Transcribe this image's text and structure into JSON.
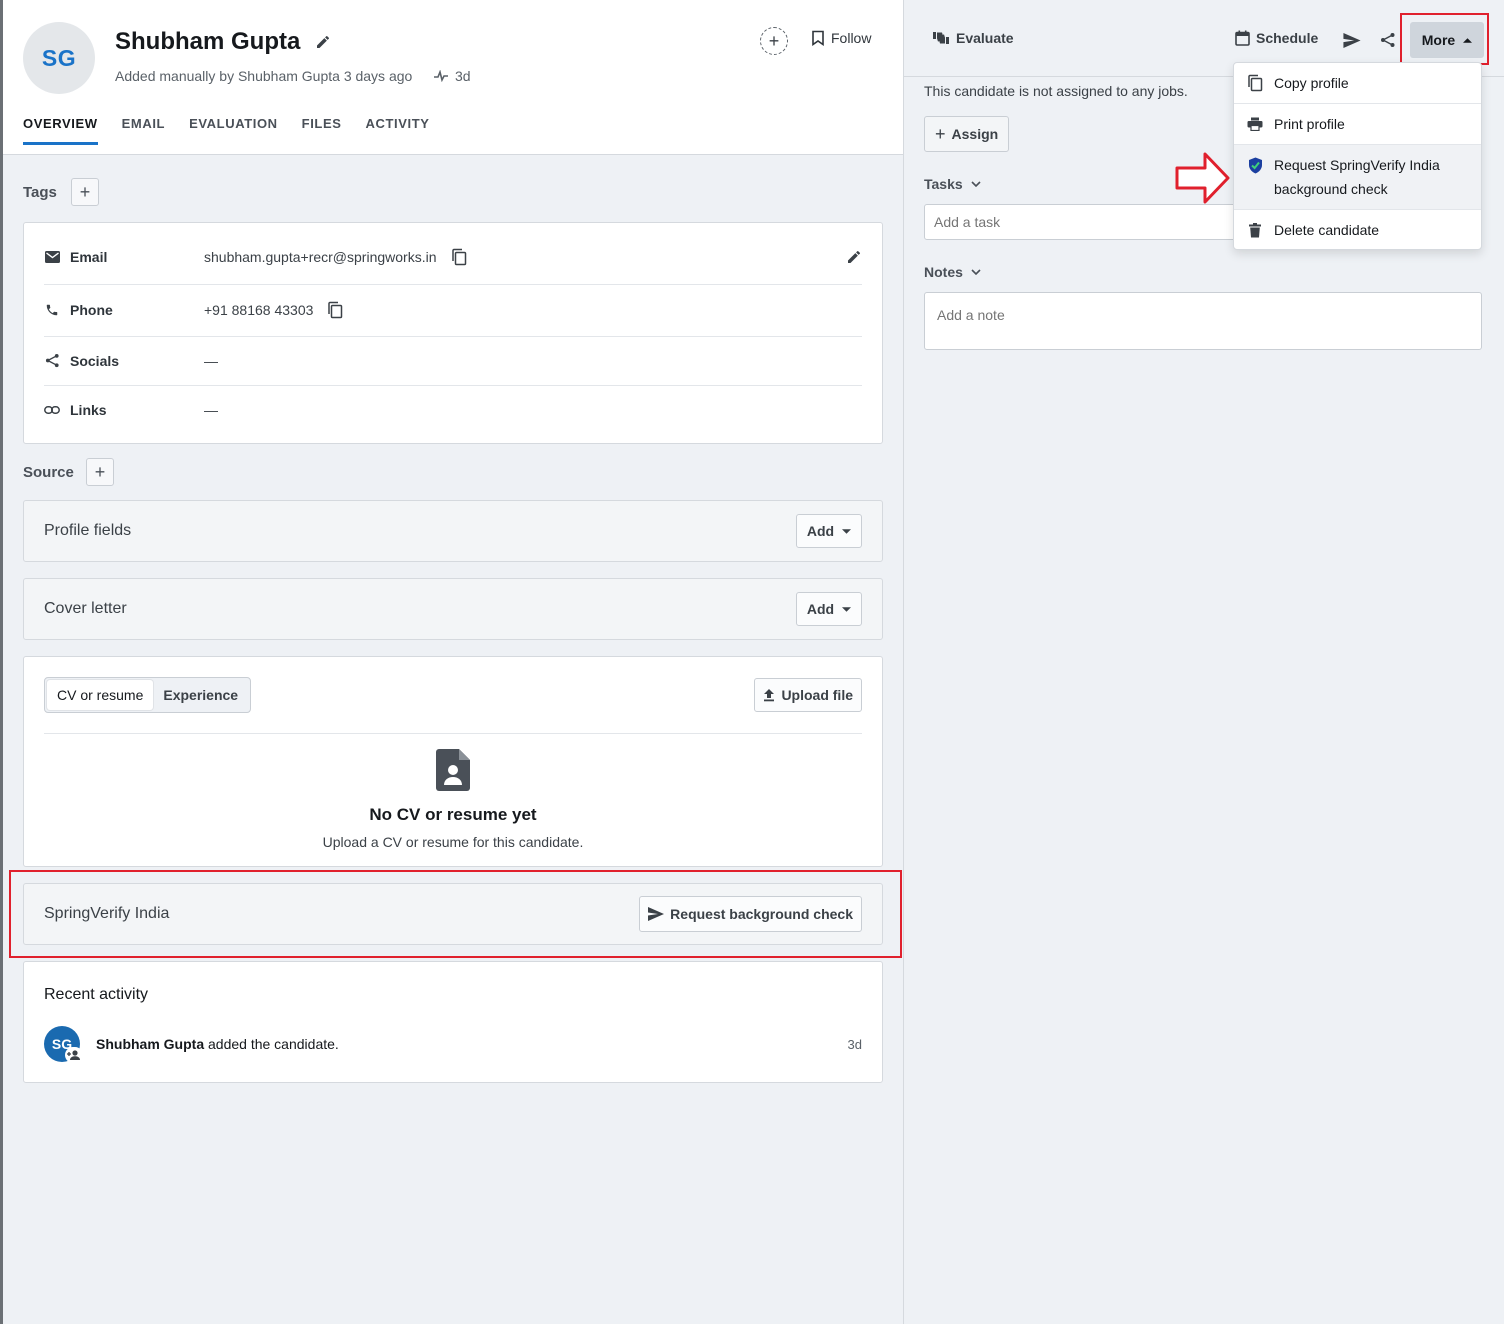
{
  "candidate": {
    "initials": "SG",
    "name": "Shubham Gupta",
    "added_text": "Added manually by Shubham Gupta 3 days ago",
    "age": "3d"
  },
  "header": {
    "follow_label": "Follow"
  },
  "tabs": [
    {
      "label": "OVERVIEW",
      "active": true
    },
    {
      "label": "EMAIL"
    },
    {
      "label": "EVALUATION"
    },
    {
      "label": "FILES"
    },
    {
      "label": "ACTIVITY"
    }
  ],
  "tags": {
    "label": "Tags"
  },
  "contact": {
    "email": {
      "label": "Email",
      "value": "shubham.gupta+recr@springworks.in"
    },
    "phone": {
      "label": "Phone",
      "value": "+91 88168 43303"
    },
    "socials": {
      "label": "Socials",
      "value": "—"
    },
    "links": {
      "label": "Links",
      "value": "—"
    }
  },
  "source": {
    "label": "Source"
  },
  "profile_fields": {
    "title": "Profile fields",
    "add_label": "Add"
  },
  "cover_letter": {
    "title": "Cover letter",
    "add_label": "Add"
  },
  "resume": {
    "seg_cv": "CV or resume",
    "seg_experience": "Experience",
    "upload_label": "Upload file",
    "empty_title": "No CV or resume yet",
    "empty_subtitle": "Upload a CV or resume for this candidate."
  },
  "springverify": {
    "title": "SpringVerify India",
    "button_label": "Request background check"
  },
  "recent_activity": {
    "title": "Recent activity",
    "avatar": "SG",
    "actor": "Shubham Gupta",
    "action": " added the candidate.",
    "time": "3d"
  },
  "right": {
    "evaluate_label": "Evaluate",
    "schedule_label": "Schedule",
    "more_label": "More",
    "not_assigned": "This candidate is not assigned to any jobs.",
    "assign_label": "Assign",
    "tasks_label": "Tasks",
    "task_placeholder": "Add a task",
    "notes_label": "Notes",
    "note_placeholder": "Add a note"
  },
  "more_menu": {
    "copy_profile": "Copy profile",
    "print_profile": "Print profile",
    "request_line1": "Request SpringVerify India",
    "request_line2": "background check",
    "delete_candidate": "Delete candidate"
  },
  "colors": {
    "accent": "#1a73c8",
    "highlight": "#e0202d",
    "page_bg": "#eef1f5"
  },
  "icons": [
    "pencil-icon",
    "pulse-icon",
    "plus-circle-icon",
    "bookmark-icon",
    "mail-icon",
    "phone-icon",
    "share-icon",
    "link-icon",
    "copy-icon",
    "caret-down-icon",
    "upload-icon",
    "document-person-icon",
    "send-icon",
    "thumbs-icon",
    "calendar-icon",
    "caret-up-icon",
    "print-icon",
    "shield-check-icon",
    "trash-icon",
    "plus-icon",
    "chevron-down-icon",
    "add-person-icon"
  ]
}
